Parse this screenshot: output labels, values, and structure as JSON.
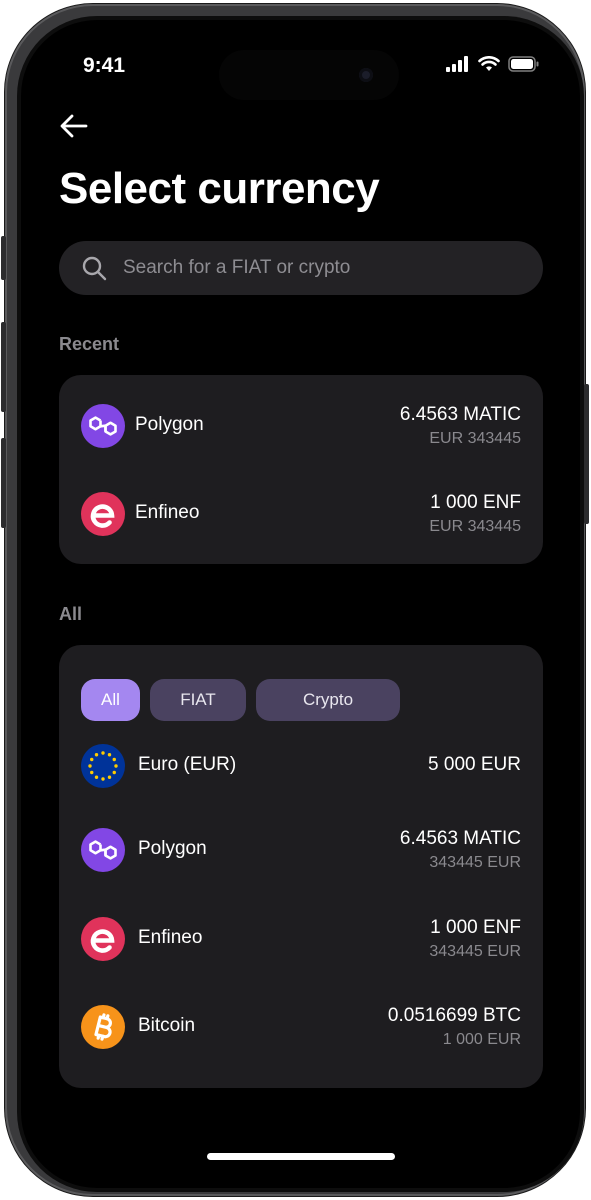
{
  "status_bar": {
    "time": "9:41"
  },
  "header": {
    "title": "Select currency"
  },
  "search": {
    "placeholder": "Search for a FIAT or crypto"
  },
  "recent": {
    "label": "Recent",
    "items": [
      {
        "name": "Polygon",
        "amount": "6.4563 MATIC",
        "fiat": "EUR 343445",
        "icon": "polygon-icon"
      },
      {
        "name": "Enfineo",
        "amount": "1 000 ENF",
        "fiat": "EUR 343445",
        "icon": "enfineo-icon"
      }
    ]
  },
  "all": {
    "label": "All",
    "filters": [
      {
        "label": "All",
        "active": true
      },
      {
        "label": "FIAT",
        "active": false
      },
      {
        "label": "Crypto",
        "active": false
      }
    ],
    "items": [
      {
        "name": "Euro (EUR)",
        "amount": "5 000 EUR",
        "icon": "eu-flag-icon"
      },
      {
        "name": "Polygon",
        "amount": "6.4563 MATIC",
        "fiat": "343445 EUR",
        "icon": "polygon-icon"
      },
      {
        "name": "Enfineo",
        "amount": "1 000 ENF",
        "fiat": "343445 EUR",
        "icon": "enfineo-icon"
      },
      {
        "name": "Bitcoin",
        "amount": "0.0516699 BTC",
        "fiat": "1 000 EUR",
        "icon": "bitcoin-icon"
      }
    ]
  },
  "colors": {
    "background": "#000000",
    "card": "#1e1d20",
    "accent": "#a487f0",
    "chip": "#4a4260",
    "polygon": "#8247e5",
    "enfineo": "#e0335b",
    "bitcoin": "#f7931a",
    "eu_blue": "#003399",
    "eu_gold": "#ffcc00"
  }
}
